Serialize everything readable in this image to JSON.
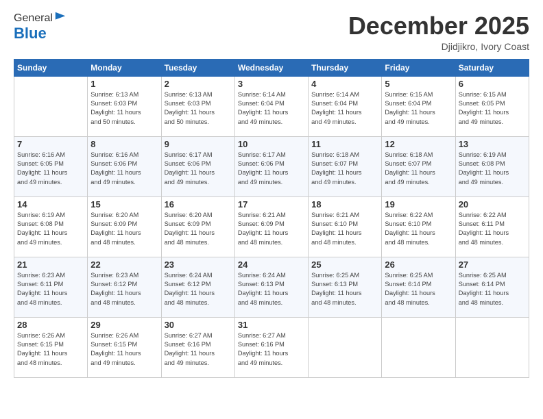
{
  "header": {
    "logo_general": "General",
    "logo_blue": "Blue",
    "month": "December 2025",
    "location": "Djidjikro, Ivory Coast"
  },
  "days_of_week": [
    "Sunday",
    "Monday",
    "Tuesday",
    "Wednesday",
    "Thursday",
    "Friday",
    "Saturday"
  ],
  "weeks": [
    [
      {
        "day": "",
        "info": ""
      },
      {
        "day": "1",
        "info": "Sunrise: 6:13 AM\nSunset: 6:03 PM\nDaylight: 11 hours\nand 50 minutes."
      },
      {
        "day": "2",
        "info": "Sunrise: 6:13 AM\nSunset: 6:03 PM\nDaylight: 11 hours\nand 50 minutes."
      },
      {
        "day": "3",
        "info": "Sunrise: 6:14 AM\nSunset: 6:04 PM\nDaylight: 11 hours\nand 49 minutes."
      },
      {
        "day": "4",
        "info": "Sunrise: 6:14 AM\nSunset: 6:04 PM\nDaylight: 11 hours\nand 49 minutes."
      },
      {
        "day": "5",
        "info": "Sunrise: 6:15 AM\nSunset: 6:04 PM\nDaylight: 11 hours\nand 49 minutes."
      },
      {
        "day": "6",
        "info": "Sunrise: 6:15 AM\nSunset: 6:05 PM\nDaylight: 11 hours\nand 49 minutes."
      }
    ],
    [
      {
        "day": "7",
        "info": "Sunrise: 6:16 AM\nSunset: 6:05 PM\nDaylight: 11 hours\nand 49 minutes."
      },
      {
        "day": "8",
        "info": "Sunrise: 6:16 AM\nSunset: 6:06 PM\nDaylight: 11 hours\nand 49 minutes."
      },
      {
        "day": "9",
        "info": "Sunrise: 6:17 AM\nSunset: 6:06 PM\nDaylight: 11 hours\nand 49 minutes."
      },
      {
        "day": "10",
        "info": "Sunrise: 6:17 AM\nSunset: 6:06 PM\nDaylight: 11 hours\nand 49 minutes."
      },
      {
        "day": "11",
        "info": "Sunrise: 6:18 AM\nSunset: 6:07 PM\nDaylight: 11 hours\nand 49 minutes."
      },
      {
        "day": "12",
        "info": "Sunrise: 6:18 AM\nSunset: 6:07 PM\nDaylight: 11 hours\nand 49 minutes."
      },
      {
        "day": "13",
        "info": "Sunrise: 6:19 AM\nSunset: 6:08 PM\nDaylight: 11 hours\nand 49 minutes."
      }
    ],
    [
      {
        "day": "14",
        "info": "Sunrise: 6:19 AM\nSunset: 6:08 PM\nDaylight: 11 hours\nand 49 minutes."
      },
      {
        "day": "15",
        "info": "Sunrise: 6:20 AM\nSunset: 6:09 PM\nDaylight: 11 hours\nand 48 minutes."
      },
      {
        "day": "16",
        "info": "Sunrise: 6:20 AM\nSunset: 6:09 PM\nDaylight: 11 hours\nand 48 minutes."
      },
      {
        "day": "17",
        "info": "Sunrise: 6:21 AM\nSunset: 6:09 PM\nDaylight: 11 hours\nand 48 minutes."
      },
      {
        "day": "18",
        "info": "Sunrise: 6:21 AM\nSunset: 6:10 PM\nDaylight: 11 hours\nand 48 minutes."
      },
      {
        "day": "19",
        "info": "Sunrise: 6:22 AM\nSunset: 6:10 PM\nDaylight: 11 hours\nand 48 minutes."
      },
      {
        "day": "20",
        "info": "Sunrise: 6:22 AM\nSunset: 6:11 PM\nDaylight: 11 hours\nand 48 minutes."
      }
    ],
    [
      {
        "day": "21",
        "info": "Sunrise: 6:23 AM\nSunset: 6:11 PM\nDaylight: 11 hours\nand 48 minutes."
      },
      {
        "day": "22",
        "info": "Sunrise: 6:23 AM\nSunset: 6:12 PM\nDaylight: 11 hours\nand 48 minutes."
      },
      {
        "day": "23",
        "info": "Sunrise: 6:24 AM\nSunset: 6:12 PM\nDaylight: 11 hours\nand 48 minutes."
      },
      {
        "day": "24",
        "info": "Sunrise: 6:24 AM\nSunset: 6:13 PM\nDaylight: 11 hours\nand 48 minutes."
      },
      {
        "day": "25",
        "info": "Sunrise: 6:25 AM\nSunset: 6:13 PM\nDaylight: 11 hours\nand 48 minutes."
      },
      {
        "day": "26",
        "info": "Sunrise: 6:25 AM\nSunset: 6:14 PM\nDaylight: 11 hours\nand 48 minutes."
      },
      {
        "day": "27",
        "info": "Sunrise: 6:25 AM\nSunset: 6:14 PM\nDaylight: 11 hours\nand 48 minutes."
      }
    ],
    [
      {
        "day": "28",
        "info": "Sunrise: 6:26 AM\nSunset: 6:15 PM\nDaylight: 11 hours\nand 48 minutes."
      },
      {
        "day": "29",
        "info": "Sunrise: 6:26 AM\nSunset: 6:15 PM\nDaylight: 11 hours\nand 49 minutes."
      },
      {
        "day": "30",
        "info": "Sunrise: 6:27 AM\nSunset: 6:16 PM\nDaylight: 11 hours\nand 49 minutes."
      },
      {
        "day": "31",
        "info": "Sunrise: 6:27 AM\nSunset: 6:16 PM\nDaylight: 11 hours\nand 49 minutes."
      },
      {
        "day": "",
        "info": ""
      },
      {
        "day": "",
        "info": ""
      },
      {
        "day": "",
        "info": ""
      }
    ]
  ]
}
